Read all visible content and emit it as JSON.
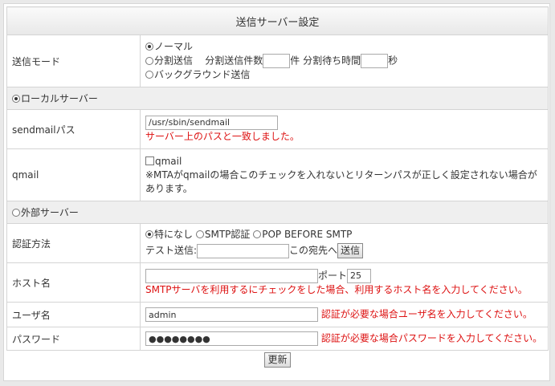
{
  "title": "送信サーバー設定",
  "send_mode": {
    "label": "送信モード",
    "normal": "ノーマル",
    "split": "分割送信",
    "split_count_label": "分割送信件数",
    "split_count_unit": "件",
    "split_wait_label": "分割待ち時間",
    "split_wait_unit": "秒",
    "background": "バックグラウンド送信",
    "selected": "normal"
  },
  "local_server": {
    "label": "ローカルサーバー",
    "sendmail_label": "sendmailパス",
    "sendmail_value": "/usr/sbin/sendmail",
    "sendmail_note": "サーバー上のパスと一致しました。",
    "qmail_label": "qmail",
    "qmail_checkbox": "qmail",
    "qmail_note": "※MTAがqmailの場合このチェックを入れないとリターンパスが正しく設定されない場合があります。"
  },
  "external_server": {
    "label": "外部サーバー",
    "auth_label": "認証方法",
    "auth_none": "特になし",
    "auth_smtp": "SMTP認証",
    "auth_pop": "POP BEFORE SMTP",
    "test_send_label": "テスト送信:",
    "test_send_suffix": "この宛先へ",
    "send_button": "送信",
    "host_label": "ホスト名",
    "host_value": "",
    "port_label": "ポート",
    "port_value": "25",
    "host_note": "SMTPサーバを利用するにチェックをした場合、利用するホスト名を入力してください。",
    "user_label": "ユーザ名",
    "user_value": "admin",
    "user_note": "認証が必要な場合ユーザ名を入力してください。",
    "password_label": "パスワード",
    "password_value": "●●●●●●●●",
    "password_note": "認証が必要な場合パスワードを入力してください。"
  },
  "submit_button": "更新"
}
